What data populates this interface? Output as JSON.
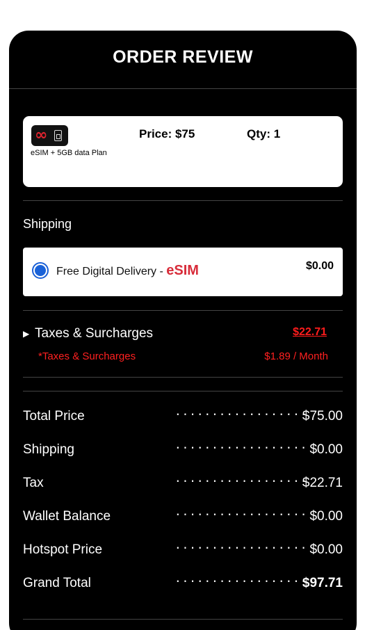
{
  "header": {
    "title": "ORDER REVIEW"
  },
  "product": {
    "icon": "infinity-sim-icon",
    "description": "eSIM + 5GB data Plan",
    "price_label": "Price: $75",
    "qty_label": "Qty: 1"
  },
  "shipping": {
    "section_label": "Shipping",
    "option_name": "Free Digital Delivery - ",
    "option_badge": "eSIM",
    "option_price": "$0.00"
  },
  "taxes": {
    "label": "Taxes & Surcharges",
    "value": "$22.71",
    "note_label": "*Taxes & Surcharges",
    "note_value": "$1.89 / Month"
  },
  "summary": {
    "dots": "..................",
    "rows": [
      {
        "label": "Total Price",
        "value": "$75.00"
      },
      {
        "label": "Shipping",
        "value": "$0.00"
      },
      {
        "label": "Tax",
        "value": "$22.71"
      },
      {
        "label": "Wallet Balance",
        "value": "$0.00"
      },
      {
        "label": "Hotspot Price",
        "value": "$0.00"
      },
      {
        "label": "Grand Total",
        "value": "$97.71"
      }
    ]
  },
  "colors": {
    "panel_bg": "#000000",
    "accent_red": "#ff1c1c",
    "esim_red": "#d82c3a",
    "radio_blue": "#1a62d8"
  }
}
